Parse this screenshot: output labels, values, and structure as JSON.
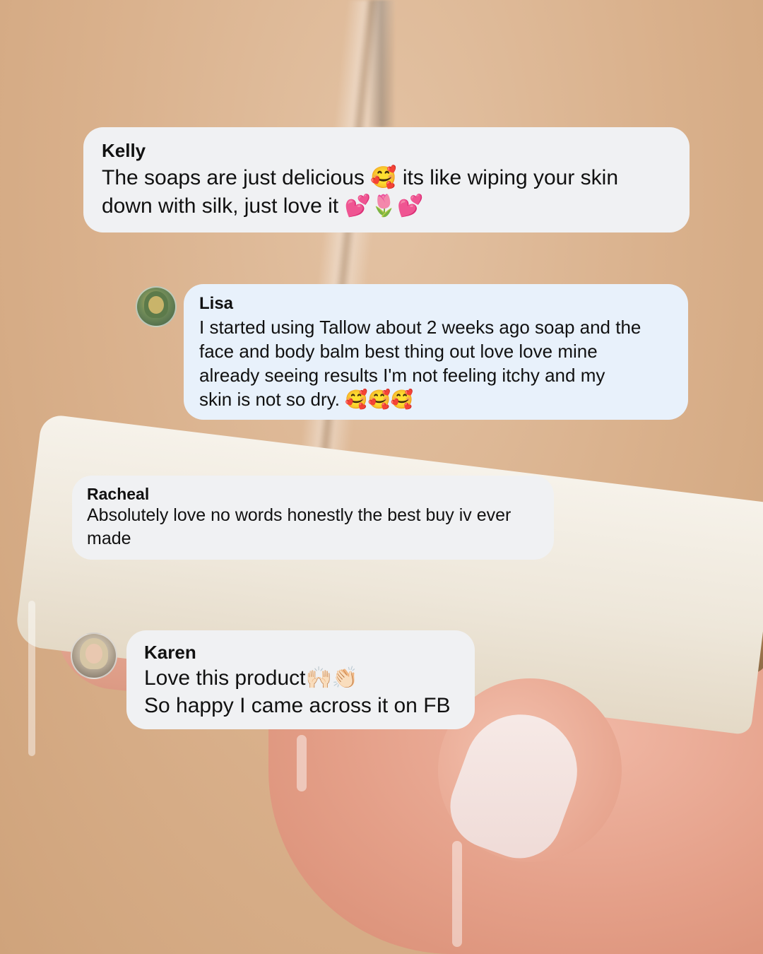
{
  "comments": [
    {
      "author": "Kelly",
      "text": "The soaps are just delicious 🥰 its like wiping your skin\ndown with silk, just love it 💕🌷💕",
      "has_avatar": false
    },
    {
      "author": "Lisa",
      "text": "I started using Tallow about 2 weeks ago soap and the\nface and body balm best thing out love love mine\nalready seeing results I'm not feeling itchy and my\nskin is not so dry. 🥰🥰🥰",
      "has_avatar": true
    },
    {
      "author": "Racheal",
      "text": "Absolutely love no words honestly the best buy iv ever\nmade",
      "has_avatar": false
    },
    {
      "author": "Karen",
      "text": "Love this product🙌🏻👏🏻\nSo happy I came across it on FB",
      "has_avatar": true
    }
  ],
  "colors": {
    "background": "#dcb592",
    "bubble": "#f0f1f3",
    "bubble_highlight": "#e8f1fb",
    "text": "#111111"
  },
  "icons": {
    "lisa_avatar": "profile-photo",
    "karen_avatar": "profile-photo"
  }
}
